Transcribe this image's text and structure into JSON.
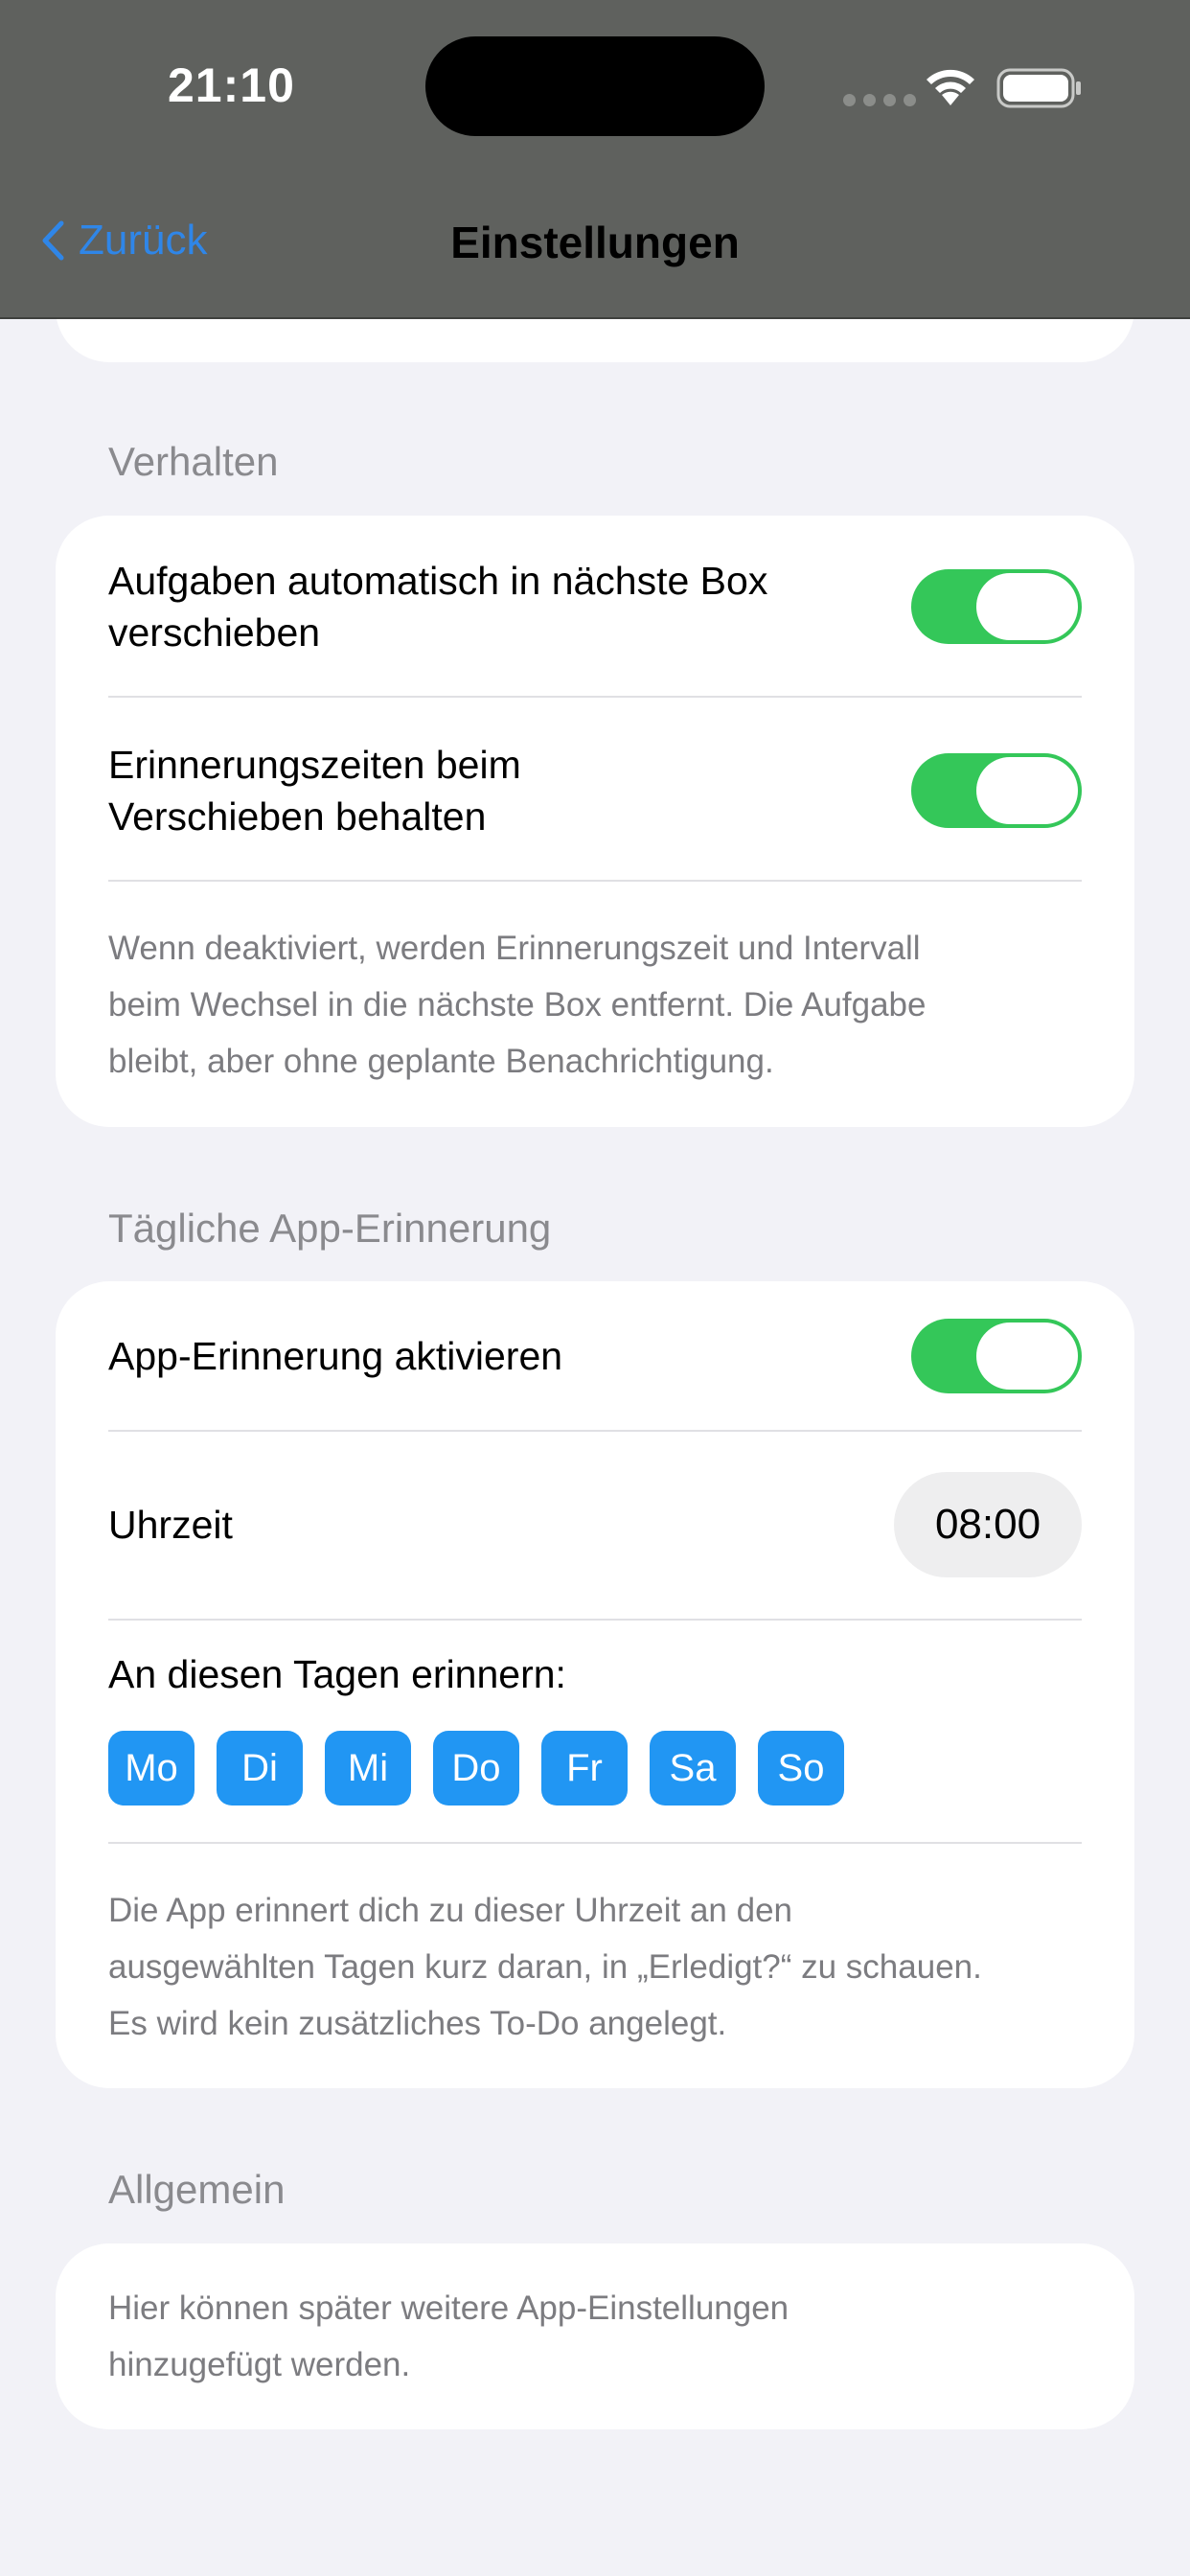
{
  "status_bar": {
    "time": "21:10"
  },
  "nav": {
    "back_label": "Zurück",
    "title": "Einstellungen"
  },
  "sections": {
    "behavior": {
      "label": "Verhalten",
      "auto_move": {
        "label_line1": "Aufgaben automatisch in nächste Box",
        "label_line2": "verschieben",
        "on": true
      },
      "keep_times": {
        "label_line1": "Erinnerungszeiten beim",
        "label_line2": "Verschieben behalten",
        "on": true
      },
      "note_line1": "Wenn deaktiviert, werden Erinnerungszeit und Intervall",
      "note_line2": "beim Wechsel in die nächste Box entfernt. Die Aufgabe",
      "note_line3": "bleibt, aber ohne geplante Benachrichtigung."
    },
    "daily": {
      "label": "Tägliche App-Erinnerung",
      "enable": {
        "label": "App-Erinnerung aktivieren",
        "on": true
      },
      "time": {
        "label": "Uhrzeit",
        "value": "08:00"
      },
      "days_label": "An diesen Tagen erinnern:",
      "days": [
        "Mo",
        "Di",
        "Mi",
        "Do",
        "Fr",
        "Sa",
        "So"
      ],
      "note_line1": "Die App erinnert dich zu dieser Uhrzeit an den",
      "note_line2": "ausgewählten Tagen kurz daran, in „Erledigt?“ zu schauen.",
      "note_line3": "Es wird kein zusätzliches To-Do angelegt."
    },
    "general": {
      "label": "Allgemein",
      "note_line1": "Hier können später weitere App-Einstellungen",
      "note_line2": "hinzugefügt werden."
    }
  },
  "colors": {
    "accent": "#2f86e8",
    "toggle_on": "#34c759",
    "day_chip": "#2196f3",
    "header_bg": "#5f615e",
    "page_bg": "#f2f2f7"
  }
}
